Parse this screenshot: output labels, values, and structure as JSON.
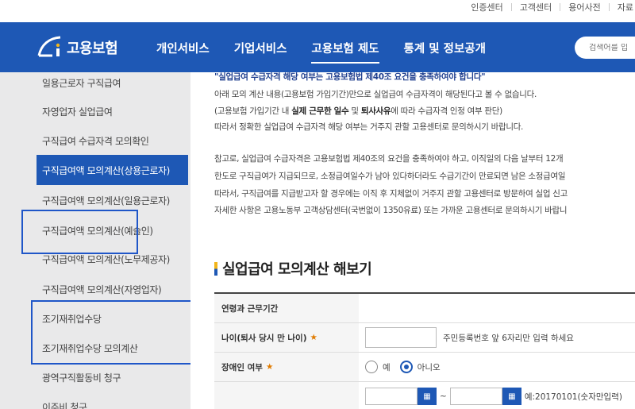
{
  "util_links": [
    "인증센터",
    "고객센터",
    "용어사전",
    "자료"
  ],
  "logo_text": "고용보험",
  "gnb": [
    {
      "label": "개인서비스",
      "active": false
    },
    {
      "label": "기업서비스",
      "active": false
    },
    {
      "label": "고용보험 제도",
      "active": true
    },
    {
      "label": "통계 및 정보공개",
      "active": false
    }
  ],
  "search": {
    "placeholder": "검색어를 입"
  },
  "sidebar": [
    {
      "label": "일용근로자 구직급여",
      "active": false
    },
    {
      "label": "자영업자 실업급여",
      "active": false
    },
    {
      "label": "구직급여 수급자격 모의확인",
      "active": false
    },
    {
      "label": "구직급여액 모의계산(상용근로자)",
      "active": true
    },
    {
      "label": "구직급여액 모의계산(일용근로자)",
      "active": false
    },
    {
      "label": "구직급여액 모의계산(예술인)",
      "active": false
    },
    {
      "label": "구직급여액 모의계산(노무제공자)",
      "active": false
    },
    {
      "label": "구직급여액 모의계산(자영업자)",
      "active": false
    },
    {
      "label": "조기재취업수당",
      "active": false
    },
    {
      "label": "조기재취업수당 모의계산",
      "active": false
    },
    {
      "label": "광역구직활동비 청구",
      "active": false
    },
    {
      "label": "이주비 청구",
      "active": false
    }
  ],
  "notice": {
    "headline": "\"실업급여 수급자격 해당 여부는 고용보험법 제40조 요건을 충족하여야 합니다\"",
    "line1": "아래 모의 계산 내용(고용보험 가입기간)만으로 실업급여 수급자격이 해당된다고 볼 수 없습니다.",
    "line2_pre": "(고용보험 가입기간 내 ",
    "line2_b1": "실제 근무한 일수",
    "line2_mid": " 및 ",
    "line2_b2": "퇴사사유",
    "line2_post": "에 따라 수급자격 인정 여부 판단)",
    "line3": "따라서 정확한 실업급여 수급자격 해당 여부는 거주지 관할 고용센터로 문의하시기 바랍니다.",
    "ref1": "참고로, 실업급여 수급자격은 고용보험법 제40조의 요건을 충족하여야 하고, 이직일의 다음 날부터 12개",
    "ref2": "한도로 구직급여가 지급되므로, 소정급여일수가 남아 있다하더라도 수급기간이 만료되면 남은 소정급여일",
    "ref3": "따라서, 구직급여를 지급받고자 할 경우에는 이직 후 지체없이 거주지 관할 고용센터로 방문하여 실업 신고",
    "ref4": "자세한 사항은 고용노동부 고객상담센터(국번없이 1350유료) 또는 가까운 고용센터로 문의하시기 바랍니"
  },
  "section_title": "실업급여 모의계산 해보기",
  "form": {
    "header_label": "연령과 근무기간",
    "age_label": "나이(퇴사 당시 만 나이)",
    "required_mark": "★",
    "age_hint": "주민등록번호 앞 6자리만 입력 하세요",
    "disability_label": "장애인 여부",
    "option_yes": "예",
    "option_no": "아니오",
    "selected": "아니오",
    "date_hint": "예:20170101(숫자만입력)",
    "tilde": "~"
  }
}
